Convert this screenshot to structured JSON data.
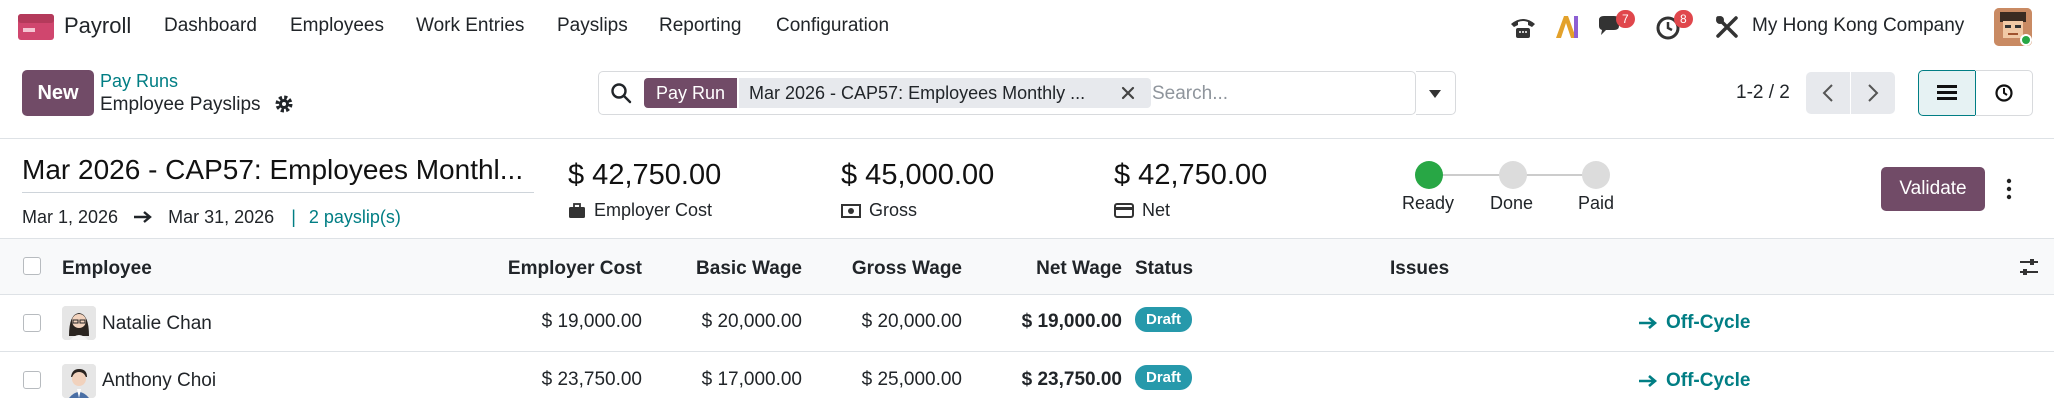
{
  "nav": {
    "app_name": "Payroll",
    "menu": [
      "Dashboard",
      "Employees",
      "Work Entries",
      "Payslips",
      "Reporting",
      "Configuration"
    ],
    "chat_badge": "7",
    "activity_badge": "8",
    "company": "My Hong Kong Company",
    "icons": [
      "phone-icon",
      "ai-icon",
      "chat-icon",
      "activity-clock-icon",
      "tools-icon"
    ]
  },
  "control": {
    "new_label": "New",
    "breadcrumb_parent": "Pay Runs",
    "breadcrumb_current": "Employee Payslips",
    "facet_label": "Pay Run",
    "facet_value": "Mar 2026 - CAP57: Employees Monthly ...",
    "search_placeholder": "Search...",
    "pager": "1-2 / 2"
  },
  "header": {
    "run_name": "Mar 2026 - CAP57: Employees Monthl...",
    "date_start": "Mar 1, 2026",
    "date_end": "Mar 31, 2026",
    "separator": "|",
    "payslip_count": "2 payslip(s)",
    "kpis": [
      {
        "value": "$ 42,750.00",
        "label": "Employer Cost",
        "icon": "briefcase-icon"
      },
      {
        "value": "$ 45,000.00",
        "label": "Gross",
        "icon": "money-icon"
      },
      {
        "value": "$ 42,750.00",
        "label": "Net",
        "icon": "credit-card-icon"
      }
    ],
    "steps": [
      {
        "label": "Ready",
        "current": true
      },
      {
        "label": "Done",
        "current": false
      },
      {
        "label": "Paid",
        "current": false
      }
    ],
    "validate_label": "Validate"
  },
  "table": {
    "columns": [
      "Employee",
      "Employer Cost",
      "Basic Wage",
      "Gross Wage",
      "Net Wage",
      "Status",
      "Issues"
    ],
    "rows": [
      {
        "employee": "Natalie Chan",
        "employer_cost": "$ 19,000.00",
        "basic_wage": "$ 20,000.00",
        "gross_wage": "$ 20,000.00",
        "net_wage": "$ 19,000.00",
        "status": "Draft",
        "action": "Off-Cycle"
      },
      {
        "employee": "Anthony Choi",
        "employer_cost": "$ 23,750.00",
        "basic_wage": "$ 17,000.00",
        "gross_wage": "$ 25,000.00",
        "net_wage": "$ 23,750.00",
        "status": "Draft",
        "action": "Off-Cycle"
      }
    ]
  },
  "colors": {
    "brand": "#714b67",
    "link": "#017e84",
    "status_draft": "#2699ab",
    "step_current": "#28a745",
    "badge": "#e0474c"
  }
}
